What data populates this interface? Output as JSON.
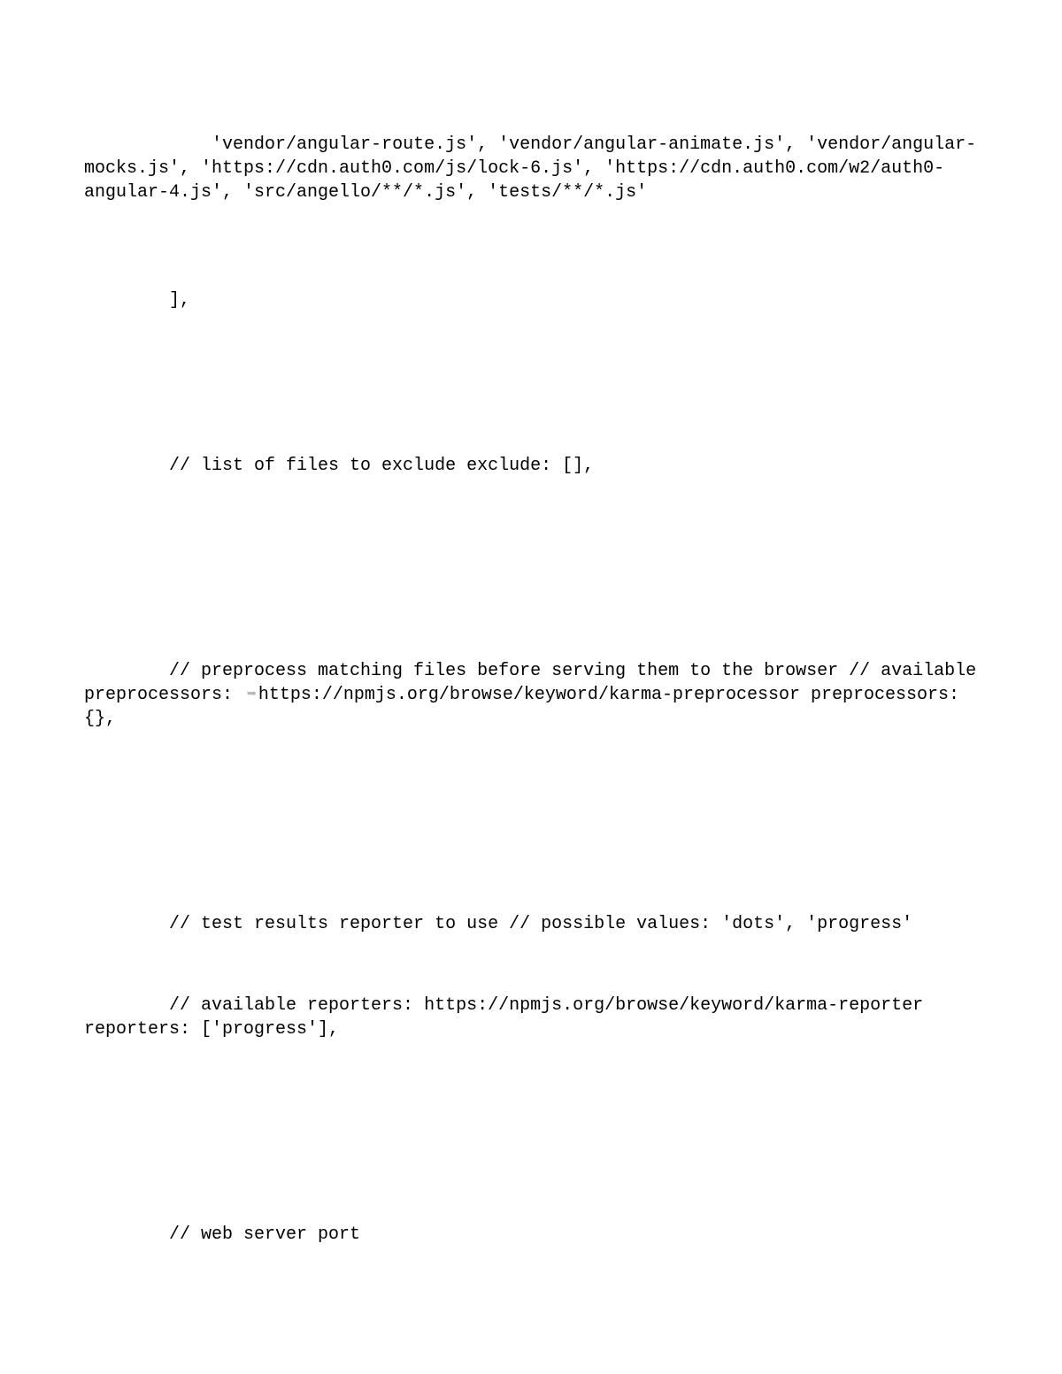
{
  "lines": {
    "filesBlock": "            'vendor/angular-route.js', 'vendor/angular-animate.js', 'vendor/angular-mocks.js', 'https://cdn.auth0.com/js/lock-6.js', 'https://cdn.auth0.com/w2/auth0-angular-4.js', 'src/angello/**/*.js', 'tests/**/*.js'",
    "closeBracket": "        ],",
    "excludeComment": "        // list of files to exclude exclude: [],",
    "preprocessPrefix": "        // preprocess matching files before serving them to the browser // available preprocessors: ",
    "preprocessLink": "https://npmjs.org/browse/keyword/karma-preprocessor",
    "preprocessSuffix": " preprocessors: {},",
    "reporterComment1": "        // test results reporter to use // possible values: 'dots', 'progress'",
    "reporterComment2": "        // available reporters: https://npmjs.org/browse/keyword/karma-reporter reporters: ['progress'],",
    "webServerPort": "        // web server port"
  }
}
